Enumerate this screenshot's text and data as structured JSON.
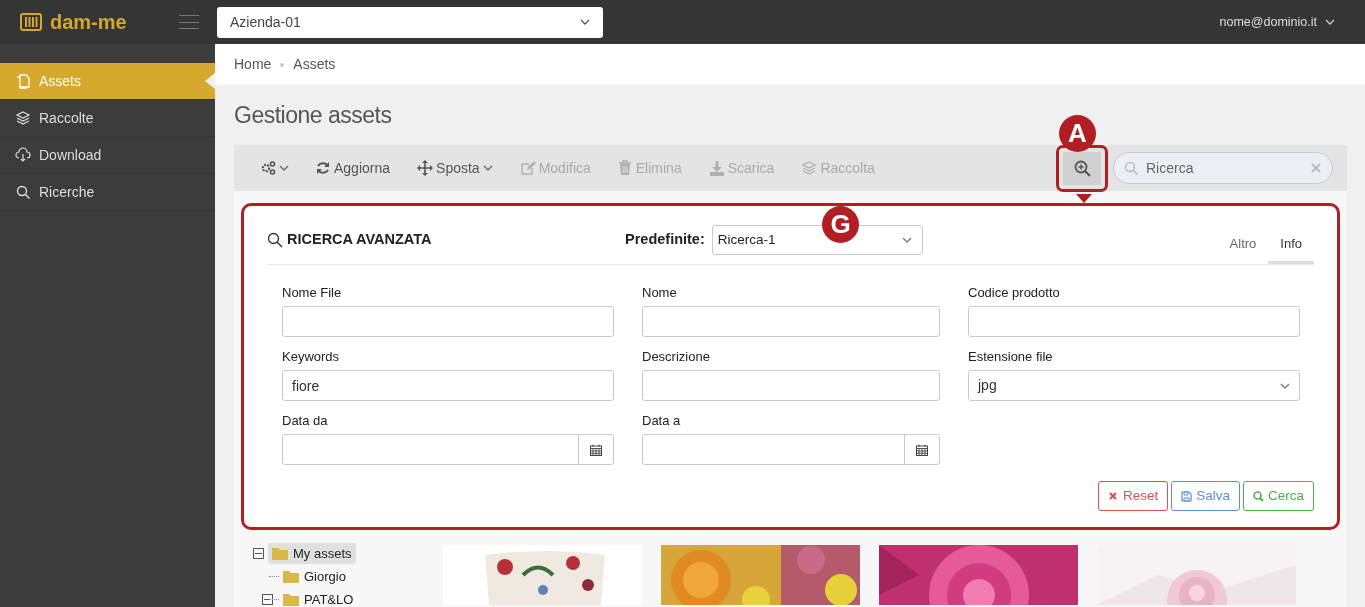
{
  "app": {
    "logo": "dam-me",
    "company": "Azienda-01",
    "user": "nome@dominio.it"
  },
  "sidebar": {
    "items": [
      {
        "label": "Assets",
        "selected": true
      },
      {
        "label": "Raccolte",
        "selected": false
      },
      {
        "label": "Download",
        "selected": false
      },
      {
        "label": "Ricerche",
        "selected": false
      }
    ]
  },
  "breadcrumb": [
    "Home",
    "Assets"
  ],
  "page_title": "Gestione assets",
  "toolbar": {
    "items": [
      {
        "dropdown": true,
        "disabled": false
      },
      {
        "label": "Aggiorna",
        "dropdown": false,
        "disabled": false
      },
      {
        "label": "Sposta",
        "dropdown": true,
        "disabled": false
      },
      {
        "label": "Modifica",
        "dropdown": false,
        "disabled": true
      },
      {
        "label": "Elimina",
        "dropdown": false,
        "disabled": true
      },
      {
        "label": "Scarica",
        "dropdown": false,
        "disabled": true
      },
      {
        "label": "Raccolta",
        "dropdown": false,
        "disabled": true
      }
    ],
    "search": {
      "placeholder": "Ricerca"
    }
  },
  "advanced_search": {
    "title": "RICERCA AVANZATA",
    "preset_label": "Predefinite:",
    "preset_value": "Ricerca-1",
    "tabs": [
      {
        "label": "Altro",
        "selected": false
      },
      {
        "label": "Info",
        "selected": true
      }
    ],
    "fields": [
      {
        "label": "Nome File",
        "kind": "text"
      },
      {
        "label": "Nome",
        "kind": "text"
      },
      {
        "label": "Codice prodotto",
        "kind": "text"
      },
      {
        "label": "Keywords",
        "kind": "text",
        "value": "fiore"
      },
      {
        "label": "Descrizione",
        "kind": "text"
      },
      {
        "label": "Estensione file",
        "kind": "select",
        "value": "jpg"
      },
      {
        "label": "Data da",
        "kind": "date"
      },
      {
        "label": "Data a",
        "kind": "date"
      }
    ],
    "buttons": [
      {
        "label": "Reset",
        "kind": "reset"
      },
      {
        "label": "Salva",
        "kind": "save"
      },
      {
        "label": "Cerca",
        "kind": "search"
      }
    ]
  },
  "tree": [
    {
      "label": "My assets",
      "selected": true,
      "expanded": true,
      "children": [
        {
          "label": "Giorgio",
          "selected": false
        },
        {
          "label": "PAT&LO",
          "selected": false,
          "expanded": true
        }
      ]
    }
  ],
  "thumbnails": [
    {
      "kind": "picture"
    },
    {
      "kind": "picture"
    },
    {
      "kind": "picture"
    },
    {
      "kind": "picture"
    }
  ],
  "annotations": [
    {
      "label": "A"
    },
    {
      "label": "G"
    }
  ]
}
